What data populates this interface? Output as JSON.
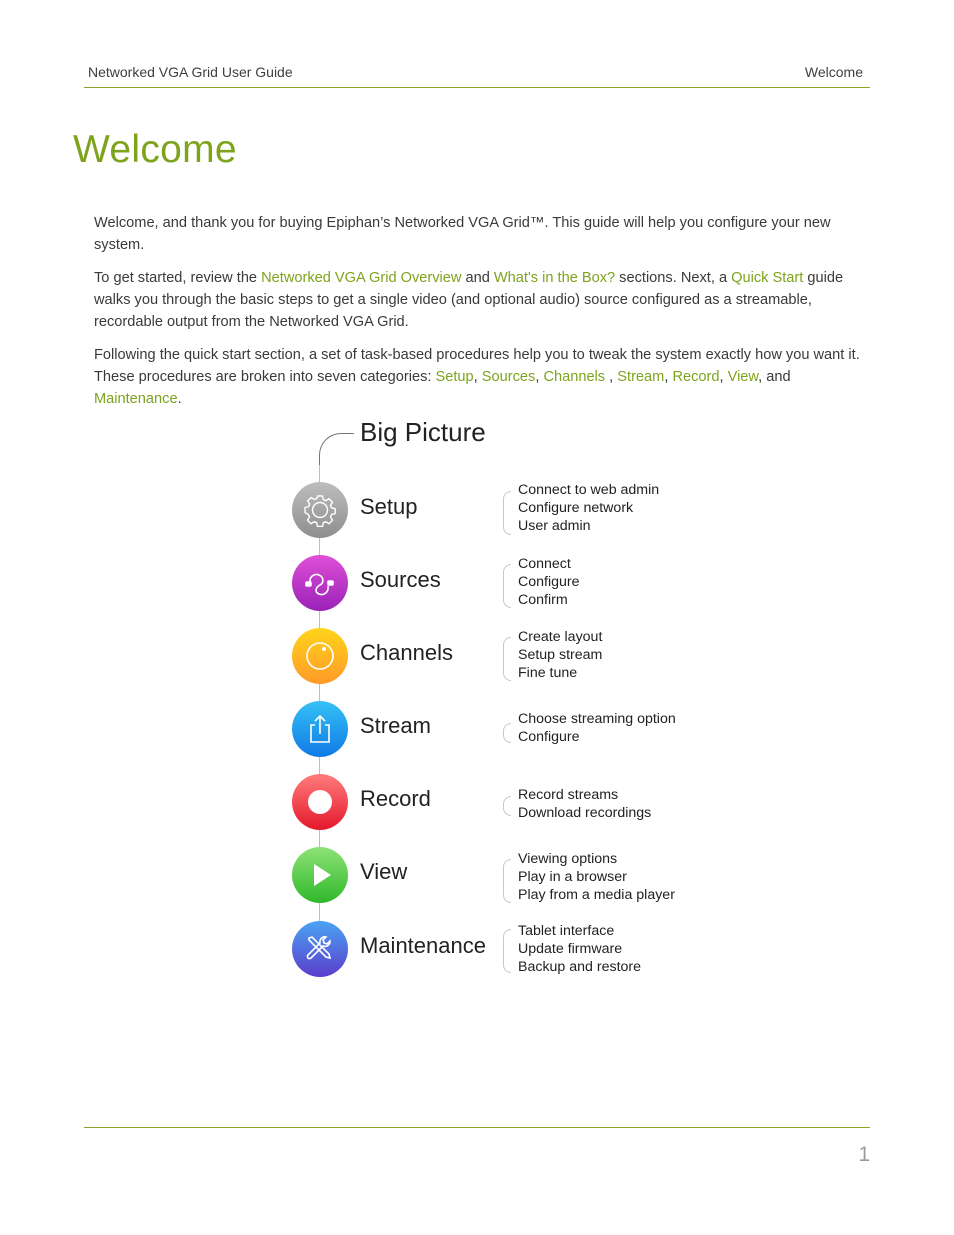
{
  "header": {
    "left": "Networked VGA Grid User Guide",
    "right": "Welcome"
  },
  "title": "Welcome",
  "paragraphs": {
    "p1": "Welcome, and thank you for buying Epiphan’s Networked VGA Grid™. This guide will help you configure your new system.",
    "p2": {
      "t1": "To get started, review the ",
      "l1": "Networked VGA Grid Overview",
      "t2": " and ",
      "l2": "What's in the Box?",
      "t3": " sections. Next, a ",
      "l3": "Quick Start",
      "t4": " guide walks you through the basic steps to get a single video (and optional audio) source configured as a streamable, recordable output from the Networked VGA Grid."
    },
    "p3": {
      "t1": "Following the quick start section, a set of task-based procedures help you to tweak the system exactly how you want it. These procedures are broken into seven categories: ",
      "links": [
        "Setup",
        "Sources",
        "Channels",
        "Stream",
        "Record",
        "View",
        "Maintenance"
      ],
      "s1": ", ",
      "s2": ", ",
      "s3": " , ",
      "s4": ", ",
      "s5": ", ",
      "s6": ", and ",
      "end": "."
    }
  },
  "link_color": "#7ea31c",
  "diagram": {
    "title": "Big Picture",
    "steps": [
      {
        "label": "Setup",
        "icon": "gear-icon",
        "color": "#9e9e9e",
        "items": [
          "Connect to web admin",
          "Configure network",
          "User admin"
        ]
      },
      {
        "label": "Sources",
        "icon": "cable-icon",
        "color": "#b334c9",
        "items": [
          "Connect",
          "Configure",
          "Confirm"
        ]
      },
      {
        "label": "Channels",
        "icon": "lens-icon",
        "color": "#ffb81c",
        "items": [
          "Create layout",
          "Setup stream",
          "Fine tune"
        ]
      },
      {
        "label": "Stream",
        "icon": "share-icon",
        "color": "#1a9bef",
        "items": [
          "Choose streaming option",
          "Configure"
        ]
      },
      {
        "label": "Record",
        "icon": "record-icon",
        "color": "#ef3b48",
        "items": [
          "Record streams",
          "Download recordings"
        ]
      },
      {
        "label": "View",
        "icon": "play-icon",
        "color": "#4cc63c",
        "items": [
          "Viewing options",
          "Play in a browser",
          "Play from a media player"
        ]
      },
      {
        "label": "Maintenance",
        "icon": "tools-icon",
        "color": "#4a5fe0",
        "items": [
          "Tablet interface",
          "Update firmware",
          "Backup and restore"
        ]
      }
    ]
  },
  "footer": {
    "page_number": "1"
  }
}
